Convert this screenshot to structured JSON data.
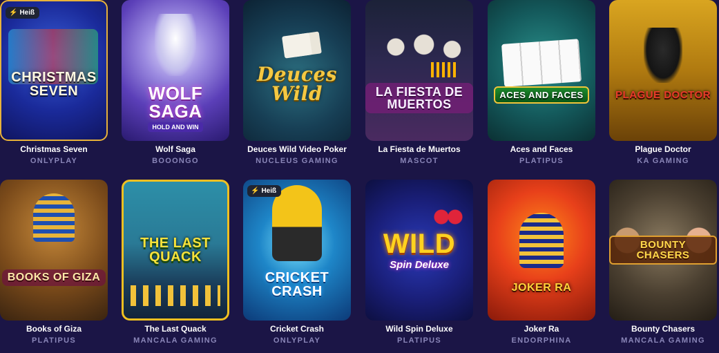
{
  "badge_label": "Heiß",
  "games": [
    {
      "name": "Christmas Seven",
      "provider": "ONLYPLAY",
      "art": "CHRISTMAS SEVEN",
      "badge": true
    },
    {
      "name": "Wolf Saga",
      "provider": "BOOONGO",
      "art": "WOLF SAGA",
      "art_sub": "HOLD AND WIN",
      "badge": false
    },
    {
      "name": "Deuces Wild Video Poker",
      "provider": "NUCLEUS GAMING",
      "art": "Deuces Wild",
      "badge": false
    },
    {
      "name": "La Fiesta de Muertos",
      "provider": "MASCOT",
      "art": "LA FIESTA DE MUERTOS",
      "badge": false
    },
    {
      "name": "Aces and Faces",
      "provider": "PLATIPUS",
      "art": "ACES AND FACES",
      "badge": false
    },
    {
      "name": "Plague Doctor",
      "provider": "KA GAMING",
      "art": "PLAGUE DOCTOR",
      "badge": false
    },
    {
      "name": "Books of Giza",
      "provider": "PLATIPUS",
      "art": "BOOKS OF GIZA",
      "badge": false
    },
    {
      "name": "The Last Quack",
      "provider": "MANCALA GAMING",
      "art": "THE LAST QUACK",
      "badge": false
    },
    {
      "name": "Cricket Crash",
      "provider": "ONLYPLAY",
      "art": "CRICKET CRASH",
      "badge": true
    },
    {
      "name": "Wild Spin Deluxe",
      "provider": "PLATIPUS",
      "art": "WILD",
      "art_sub": "Spin Deluxe",
      "badge": false
    },
    {
      "name": "Joker Ra",
      "provider": "ENDORPHINA",
      "art": "JOKER RA",
      "badge": false
    },
    {
      "name": "Bounty Chasers",
      "provider": "MANCALA GAMING",
      "art": "BOUNTY CHASERS",
      "badge": false
    }
  ]
}
